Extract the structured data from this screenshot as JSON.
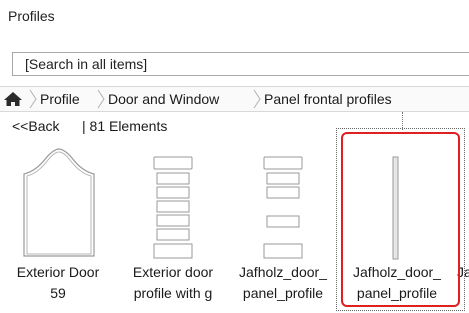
{
  "panel": {
    "title": "Profiles"
  },
  "search": {
    "placeholder": "[Search in all items]"
  },
  "breadcrumb": {
    "items": [
      "Profile",
      "Door and Window",
      "Panel frontal profiles"
    ]
  },
  "nav": {
    "back_label": "<<Back",
    "count_label": "|  81 Elements"
  },
  "tiles": [
    {
      "line1": "Exterior Door",
      "line2": "59",
      "icon": "arched-door-profile-icon"
    },
    {
      "line1": "Exterior door",
      "line2": "profile with g",
      "icon": "stacked-panel-profile-icon"
    },
    {
      "line1": "Jafholz_door_",
      "line2": "panel_profile",
      "icon": "three-panel-profile-icon"
    },
    {
      "line1": "Jafholz_door_",
      "line2": "panel_profile",
      "icon": "thin-vertical-profile-icon",
      "selected": true
    },
    {
      "line1": "Ja",
      "line2": "",
      "icon": "partial-tile-icon"
    }
  ],
  "colors": {
    "selection": "#e02020",
    "thumb_stroke": "#9a9a9a"
  }
}
